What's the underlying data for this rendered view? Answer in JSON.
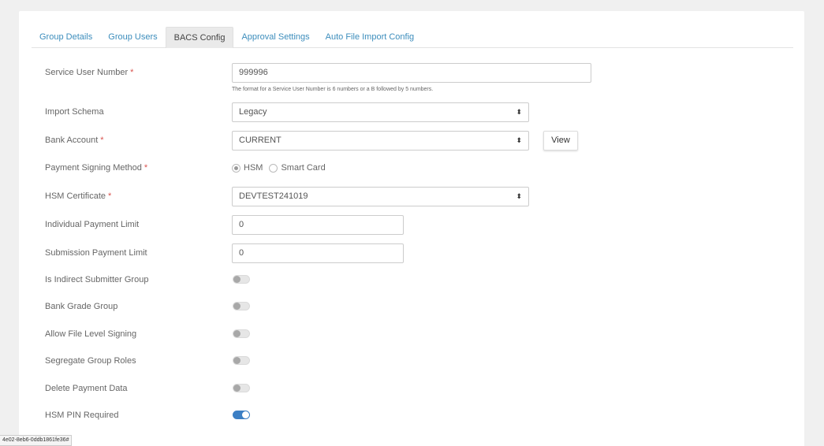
{
  "tabs": [
    {
      "label": "Group Details",
      "active": false
    },
    {
      "label": "Group Users",
      "active": false
    },
    {
      "label": "BACS Config",
      "active": true
    },
    {
      "label": "Approval Settings",
      "active": false
    },
    {
      "label": "Auto File Import Config",
      "active": false
    }
  ],
  "form": {
    "service_user_number": {
      "label": "Service User Number",
      "required_mark": "*",
      "value": "999996",
      "help": "The format for a Service User Number is 6 numbers or a B followed by 5 numbers."
    },
    "import_schema": {
      "label": "Import Schema",
      "value": "Legacy"
    },
    "bank_account": {
      "label": "Bank Account",
      "required_mark": "*",
      "value": "CURRENT",
      "view_label": "View"
    },
    "payment_signing_method": {
      "label": "Payment Signing Method",
      "required_mark": "*",
      "options": [
        "HSM",
        "Smart Card"
      ],
      "selected": "HSM"
    },
    "hsm_certificate": {
      "label": "HSM Certificate",
      "required_mark": "*",
      "value": "DEVTEST241019"
    },
    "individual_payment_limit": {
      "label": "Individual Payment Limit",
      "value": "0"
    },
    "submission_payment_limit": {
      "label": "Submission Payment Limit",
      "value": "0"
    },
    "toggles": [
      {
        "label": "Is Indirect Submitter Group",
        "on": false
      },
      {
        "label": "Bank Grade Group",
        "on": false
      },
      {
        "label": "Allow File Level Signing",
        "on": false
      },
      {
        "label": "Segregate Group Roles",
        "on": false
      },
      {
        "label": "Delete Payment Data",
        "on": false
      },
      {
        "label": "HSM PIN Required",
        "on": true
      }
    ]
  },
  "status_bar_text": "4e02-8eb6-0ddb1861fe36#",
  "colors": {
    "link": "#3c8dbc",
    "required": "#d9534f",
    "toggle_on": "#3c7fc4"
  }
}
